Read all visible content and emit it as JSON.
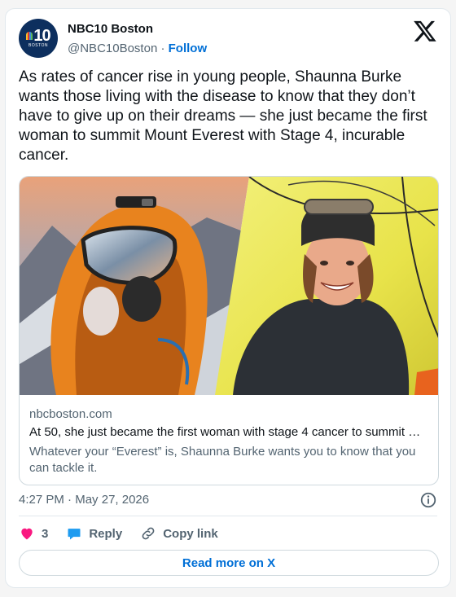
{
  "account": {
    "name": "NBC10 Boston",
    "handle": "@NBC10Boston",
    "separator": "·",
    "follow_label": "Follow",
    "avatar_number": "10",
    "avatar_sub": "BOSTON"
  },
  "tweet": {
    "text": "As rates of cancer rise in young people, Shaunna Burke wants those living with the disease to know that they don’t have to give up on their dreams — she just became the first woman to summit Mount Everest with Stage 4, incurable cancer."
  },
  "link_card": {
    "domain": "nbcboston.com",
    "title": "At 50, she just became the first woman with stage 4 cancer to summit …",
    "description": "Whatever your “Everest” is, Shaunna Burke wants you to know that you can tackle it."
  },
  "meta": {
    "time": "4:27 PM",
    "separator": "·",
    "date": "May 27, 2026"
  },
  "actions": {
    "like_count": "3",
    "reply_label": "Reply",
    "copy_label": "Copy link"
  },
  "read_more_label": "Read more on X",
  "colors": {
    "accent": "#006fd6",
    "like": "#f91880",
    "reply": "#1d9bf0",
    "muted": "#536471"
  }
}
